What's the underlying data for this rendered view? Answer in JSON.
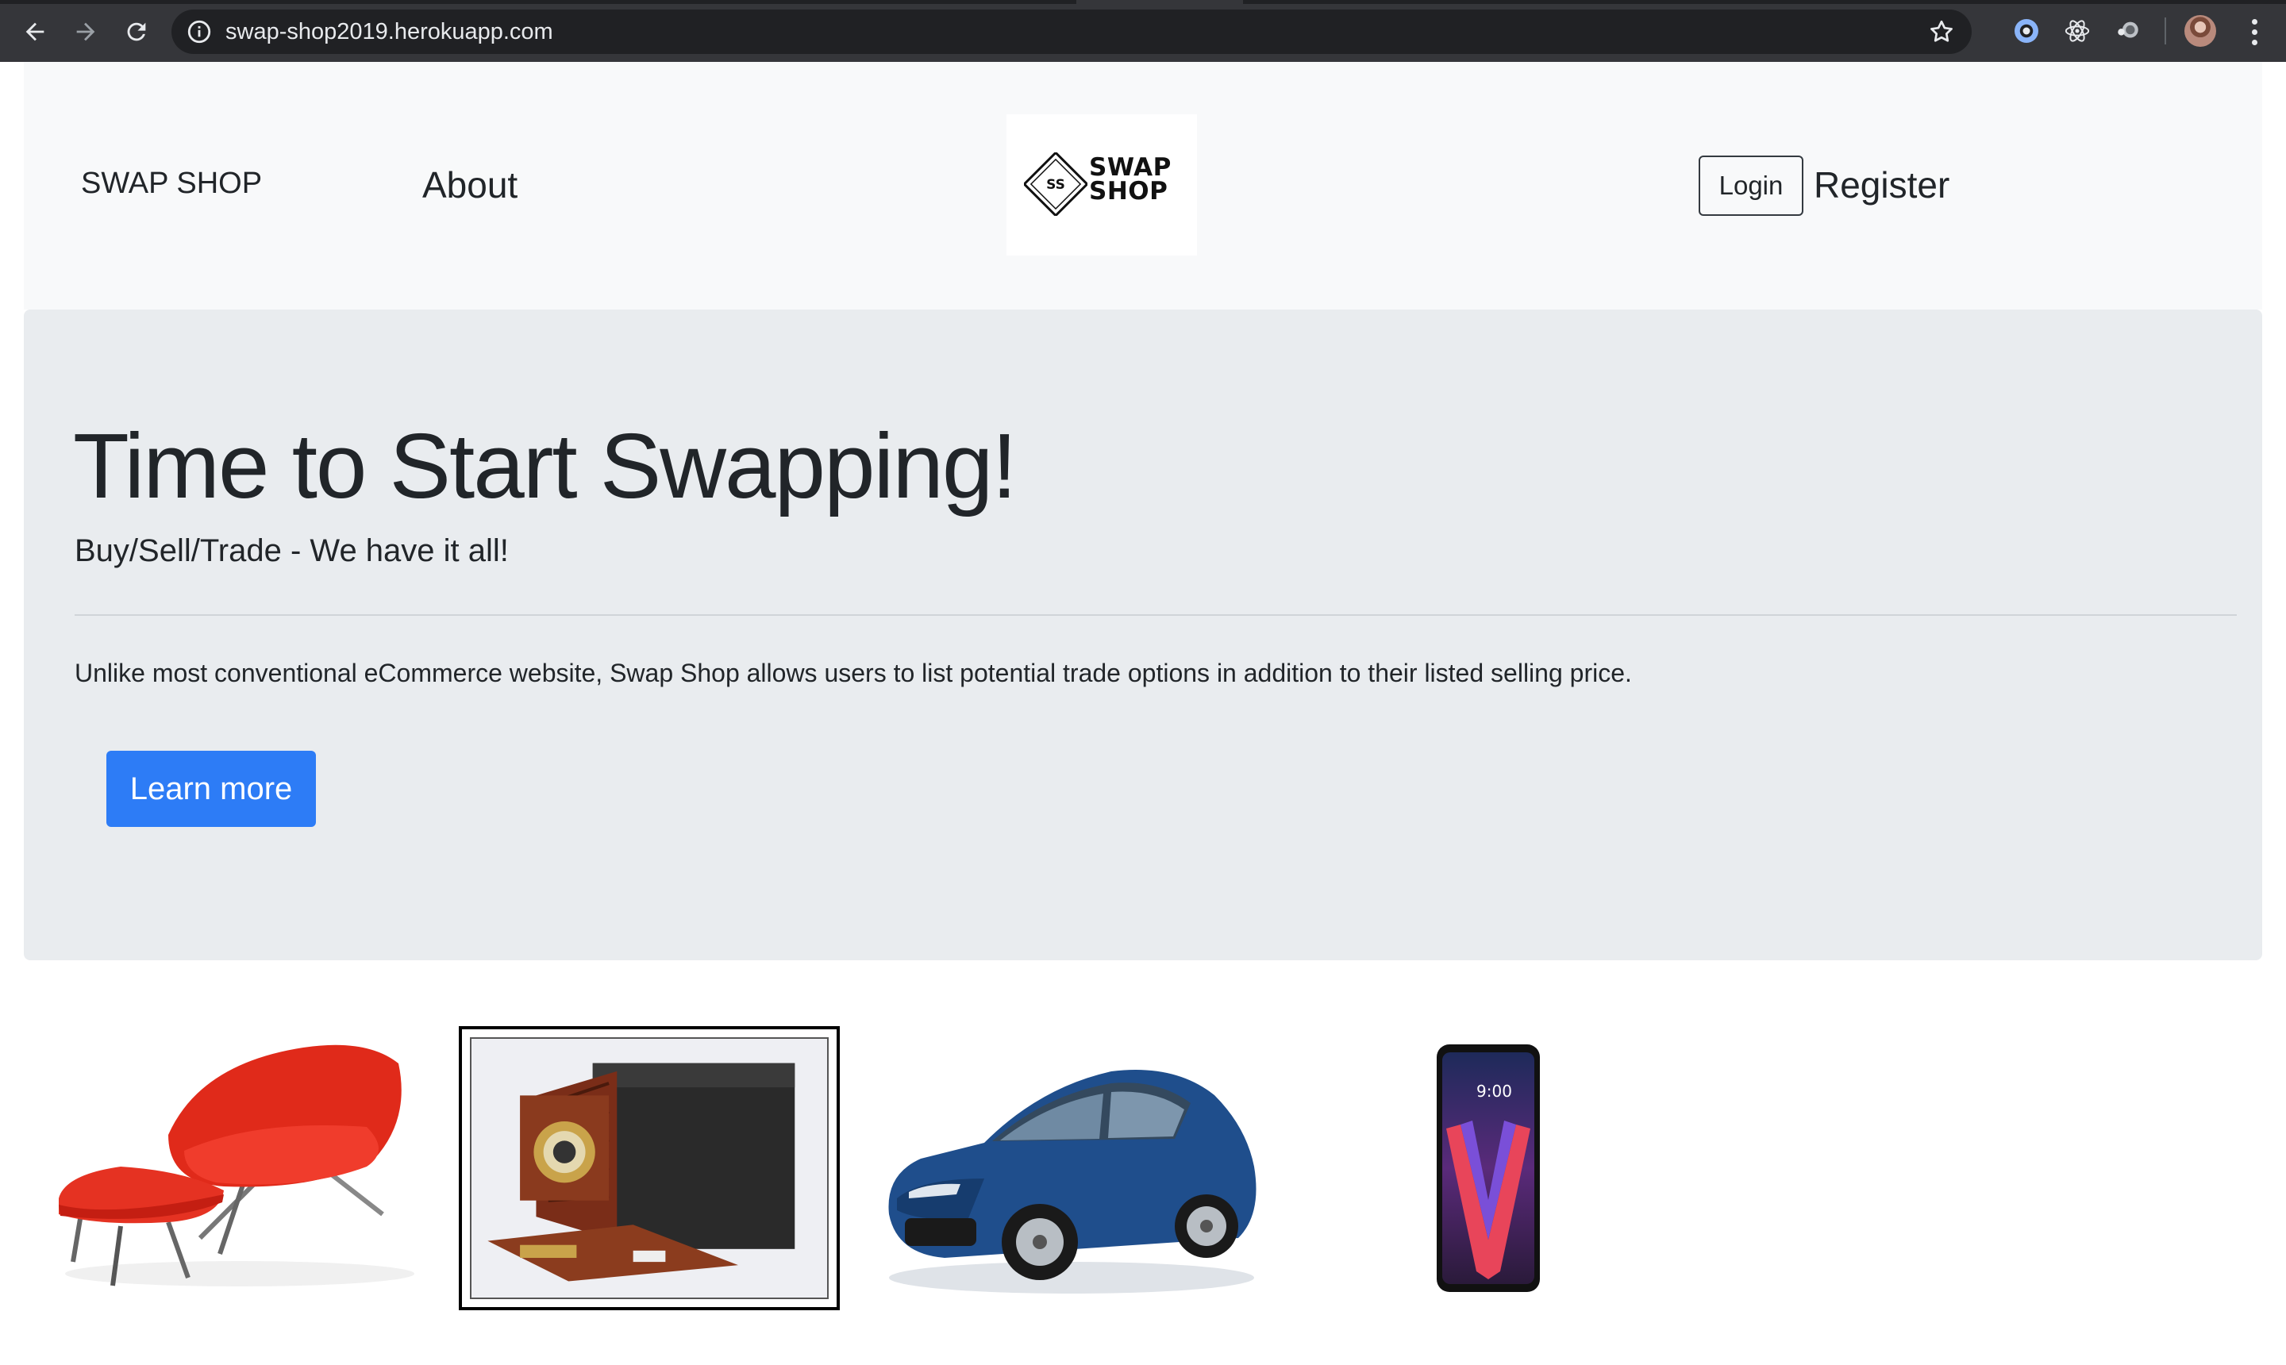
{
  "browser": {
    "url": "swap-shop2019.herokuapp.com",
    "icons": [
      "back-arrow-icon",
      "forward-arrow-icon",
      "reload-icon",
      "info-icon",
      "bookmark-star-icon",
      "extension-icon",
      "react-devtools-icon",
      "extension-icon",
      "profile-avatar",
      "more-menu-icon"
    ]
  },
  "navbar": {
    "brand": "SWAP SHOP",
    "about": "About",
    "logo_line1": "SWAP",
    "logo_line2": "SHOP",
    "logo_badge": "SS",
    "login": "Login",
    "register": "Register"
  },
  "jumbotron": {
    "title": "Time to Start Swapping!",
    "lead": "Buy/Sell/Trade - We have it all!",
    "text": "Unlike most conventional eCommerce website, Swap Shop allows users to list potential trade options in addition to their listed selling price.",
    "button": "Learn more",
    "button_color": "#2d7cf6"
  },
  "products": [
    {
      "name": "red-lounge-chair"
    },
    {
      "name": "antique-camera"
    },
    {
      "name": "blue-sedan"
    },
    {
      "name": "smartphone",
      "screen_time": "9:00"
    }
  ]
}
